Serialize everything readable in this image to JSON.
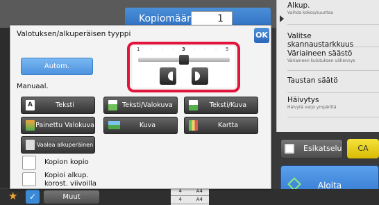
{
  "header": {
    "copies_label": "Kopiomäärä",
    "copies_value": "1"
  },
  "right_menu": {
    "items": [
      {
        "title": "Alkup.",
        "subtitle": "Vaihda kokoa/suuntaa"
      },
      {
        "title": "Valitse skannaustarkkuus",
        "subtitle": ""
      },
      {
        "title": "Väriaineen säästö",
        "subtitle": "Väriaineen kulutuksen vähennys"
      },
      {
        "title": "Taustan säätö",
        "subtitle": ""
      },
      {
        "title": "Häivytys",
        "subtitle": "Häivytä varjo ympäriltä"
      }
    ],
    "preview_label": "Esikatselu",
    "ca_label": "CA",
    "start_label": "Aloita"
  },
  "bottom": {
    "more_label": "Muut",
    "tray_rows": [
      {
        "tray": "4",
        "size": "A4"
      },
      {
        "tray": "4",
        "size": "A4"
      }
    ]
  },
  "dialog": {
    "title": "Valotuksen/alkuperäisen tyyppi",
    "ok_label": "OK",
    "exposure": {
      "scale_labels": [
        "1",
        "3",
        "5"
      ],
      "value": 3,
      "min": 1,
      "max": 5
    },
    "auto_label": "Autom.",
    "manual_label": "Manuaal.",
    "types": [
      {
        "label": "Teksti"
      },
      {
        "label": "Teksti/Valokuva"
      },
      {
        "label": "Teksti/Kuva"
      },
      {
        "label": "Painettu Valokuva"
      },
      {
        "label": "Kuva"
      },
      {
        "label": "Kartta"
      },
      {
        "label": "Vaalea alkuperäinen"
      }
    ],
    "checkboxes": [
      {
        "label": "Kopion kopio",
        "checked": false
      },
      {
        "label_line1": "Kopioi alkup.",
        "label_line2": "korost. viivoilla",
        "checked": false
      }
    ]
  },
  "colors": {
    "accent_blue": "#4d92de",
    "highlight_red": "#e3143c",
    "ca_yellow": "#f5e23a"
  }
}
